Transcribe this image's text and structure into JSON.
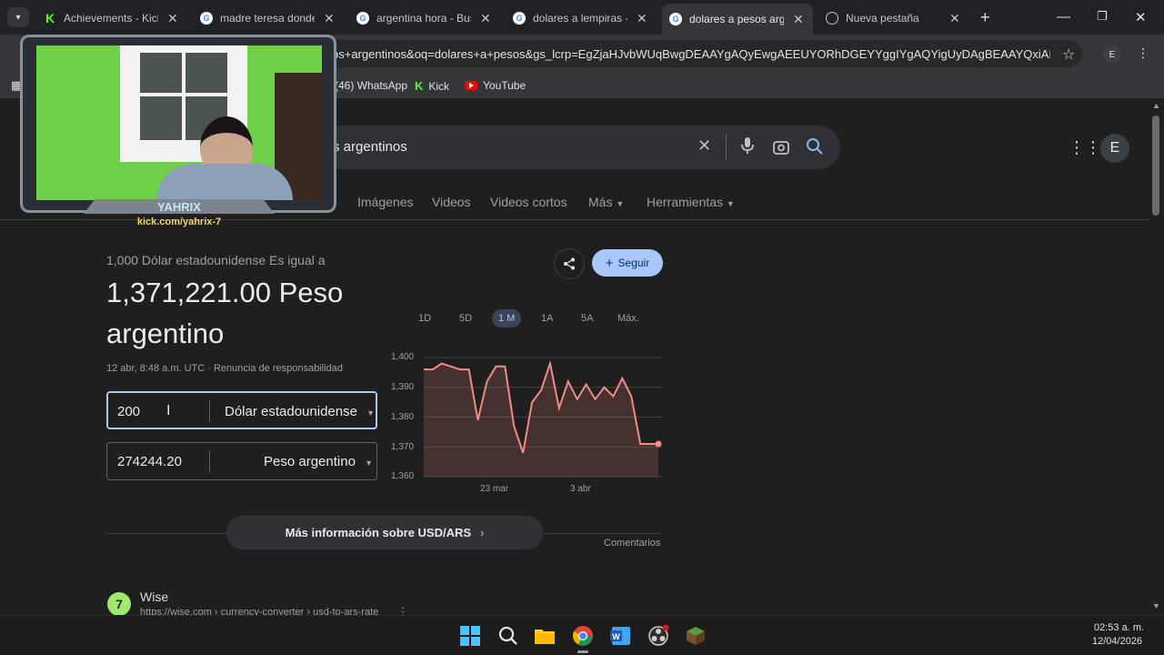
{
  "tabs": [
    {
      "label": "Achievements - Kick",
      "icon": "kick-icon"
    },
    {
      "label": "madre teresa donde",
      "icon": "google-icon"
    },
    {
      "label": "argentina hora - Busc",
      "icon": "google-icon"
    },
    {
      "label": "dolares a lempiras -",
      "icon": "google-icon"
    },
    {
      "label": "dolares a pesos arge",
      "icon": "google-icon",
      "active": true
    },
    {
      "label": "Nueva pestaña",
      "icon": "globe-icon"
    }
  ],
  "url": "os+argentinos&oq=dolares+a+pesos&gs_lcrp=EgZjaHJvbWUqBwgDEAAYgAQyEwgAEEUYORhDGEYYggIYgAQYigUyDAgBEAAYQxiAB...",
  "profile_initial": "E",
  "bookmarks": [
    {
      "label": "(46) WhatsApp"
    },
    {
      "label": "Kick"
    },
    {
      "label": "YouTube"
    }
  ],
  "search": {
    "query_visible": "s argentinos"
  },
  "nav_tabs": [
    "Imágenes",
    "Videos",
    "Videos cortos",
    "Más",
    "Herramientas"
  ],
  "converter": {
    "header": "1,000 Dólar estadounidense Es igual a",
    "result_line1": "1,371,221.00 Peso",
    "result_line2": "argentino",
    "timestamp": "12 abr, 8:48 a.m. UTC · Renuncia de responsabilidad",
    "from_value": "200",
    "from_currency": "Dólar estadounidense",
    "to_value": "274244.20",
    "to_currency": "Peso argentino",
    "follow_label": "Seguir",
    "more_info": "Más información sobre USD/ARS",
    "comments": "Comentarios"
  },
  "ranges": [
    "1D",
    "5D",
    "1 M",
    "1A",
    "5A",
    "Máx."
  ],
  "selected_range": "1 M",
  "chart_data": {
    "type": "line",
    "x_ticks": [
      "23 mar",
      "3 abr"
    ],
    "y_ticks": [
      "1,400",
      "1,390",
      "1,380",
      "1,370",
      "1,360"
    ],
    "ylim": [
      1360,
      1400
    ],
    "values": [
      1396,
      1396,
      1398,
      1397,
      1396,
      1396,
      1379,
      1392,
      1397,
      1397,
      1377,
      1368,
      1385,
      1389,
      1398,
      1383,
      1392,
      1386,
      1391,
      1386,
      1390,
      1387,
      1393,
      1387,
      1371,
      1371,
      1371
    ],
    "color": "#f28b82"
  },
  "result": {
    "site_name": "Wise",
    "site_url": "https://wise.com › currency-converter › usd-to-ars-rate"
  },
  "overlay": {
    "name": "YAHRIX",
    "link": "kick.com/yahrix-7"
  },
  "taskbar": {
    "time": "02:53 a. m.",
    "date": "12/04/2026"
  }
}
